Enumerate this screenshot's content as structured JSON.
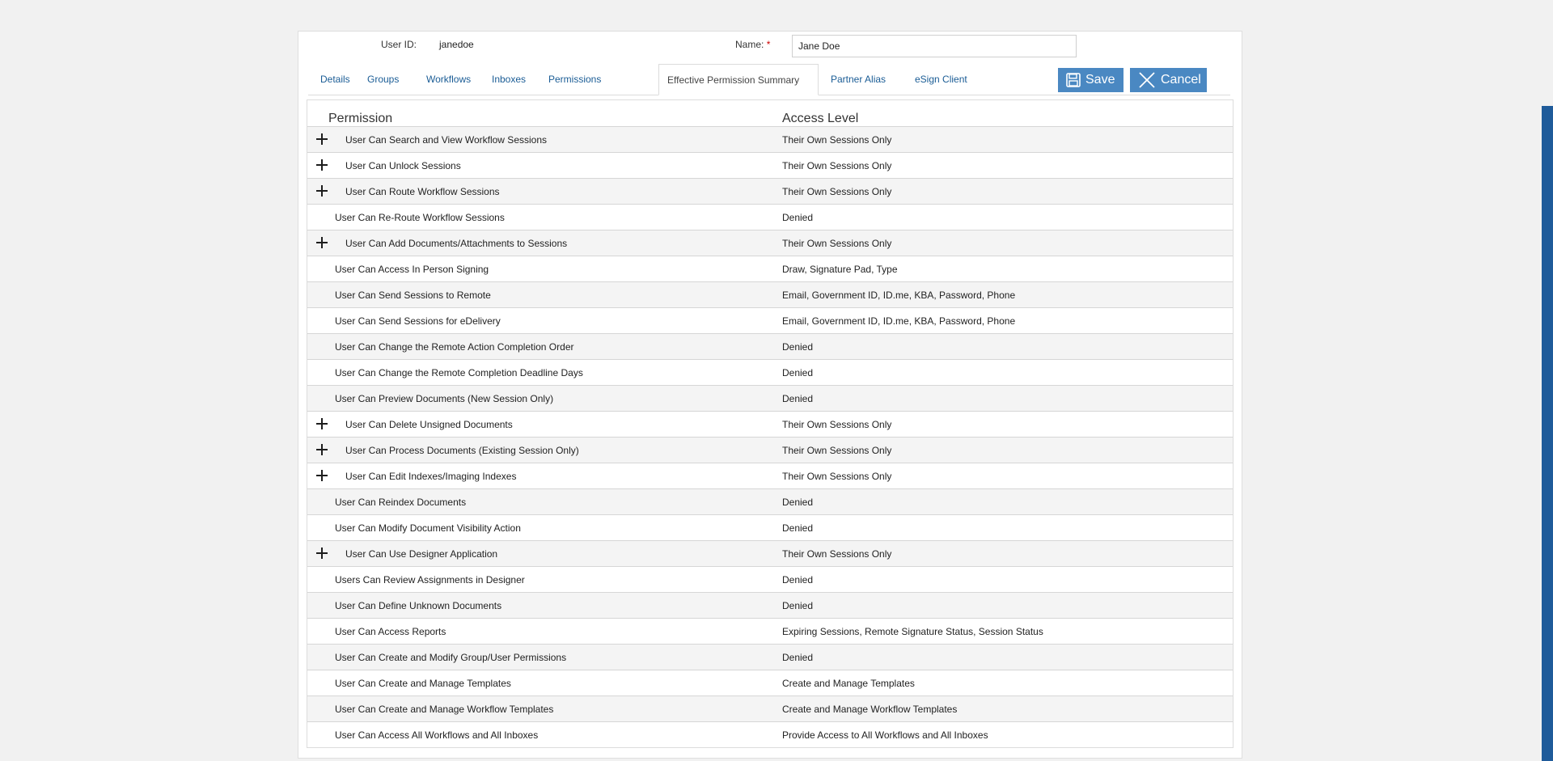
{
  "header": {
    "user_id_label": "User ID:",
    "user_id_value": "janedoe",
    "name_label": "Name:",
    "name_required": "*",
    "name_value": "Jane Doe"
  },
  "tabs": [
    {
      "label": "Details"
    },
    {
      "label": "Groups"
    },
    {
      "label": "Workflows"
    },
    {
      "label": "Inboxes"
    },
    {
      "label": "Permissions"
    },
    {
      "label": "Effective Permission Summary"
    },
    {
      "label": "Partner Alias"
    },
    {
      "label": "eSign Client"
    }
  ],
  "active_tab": "Effective Permission Summary",
  "buttons": {
    "save_label": "Save",
    "cancel_label": "Cancel",
    "save_icon": "floppy-disk-icon",
    "cancel_icon": "close-icon"
  },
  "colors": {
    "accent": "#4a88c2",
    "link": "#1a5c95",
    "required": "#cc0000"
  },
  "table": {
    "columns": [
      "Permission",
      "Access Level"
    ],
    "rows": [
      {
        "permission": "User Can Search and View Workflow Sessions",
        "access": "Their Own Sessions Only",
        "expandable": true
      },
      {
        "permission": "User Can Unlock Sessions",
        "access": "Their Own Sessions Only",
        "expandable": true
      },
      {
        "permission": "User Can Route Workflow Sessions",
        "access": "Their Own Sessions Only",
        "expandable": true
      },
      {
        "permission": "User Can Re-Route Workflow Sessions",
        "access": "Denied",
        "expandable": false
      },
      {
        "permission": "User Can Add Documents/Attachments to Sessions",
        "access": "Their Own Sessions Only",
        "expandable": true
      },
      {
        "permission": "User Can Access In Person Signing",
        "access": "Draw, Signature Pad, Type",
        "expandable": false
      },
      {
        "permission": "User Can Send Sessions to Remote",
        "access": "Email, Government ID, ID.me, KBA, Password, Phone",
        "expandable": false
      },
      {
        "permission": "User Can Send Sessions for eDelivery",
        "access": "Email, Government ID, ID.me, KBA, Password, Phone",
        "expandable": false
      },
      {
        "permission": "User Can Change the Remote Action Completion Order",
        "access": "Denied",
        "expandable": false
      },
      {
        "permission": "User Can Change the Remote Completion Deadline Days",
        "access": "Denied",
        "expandable": false
      },
      {
        "permission": "User Can Preview Documents (New Session Only)",
        "access": "Denied",
        "expandable": false
      },
      {
        "permission": "User Can Delete Unsigned Documents",
        "access": "Their Own Sessions Only",
        "expandable": true
      },
      {
        "permission": "User Can Process Documents (Existing Session Only)",
        "access": "Their Own Sessions Only",
        "expandable": true
      },
      {
        "permission": "User Can Edit Indexes/Imaging Indexes",
        "access": "Their Own Sessions Only",
        "expandable": true
      },
      {
        "permission": "User Can Reindex Documents",
        "access": "Denied",
        "expandable": false
      },
      {
        "permission": "User Can Modify Document Visibility Action",
        "access": "Denied",
        "expandable": false
      },
      {
        "permission": "User Can Use Designer Application",
        "access": "Their Own Sessions Only",
        "expandable": true
      },
      {
        "permission": "Users Can Review Assignments in Designer",
        "access": "Denied",
        "expandable": false
      },
      {
        "permission": "User Can Define Unknown Documents",
        "access": "Denied",
        "expandable": false
      },
      {
        "permission": "User Can Access Reports",
        "access": "Expiring Sessions, Remote Signature Status, Session Status",
        "expandable": false
      },
      {
        "permission": "User Can Create and Modify Group/User Permissions",
        "access": "Denied",
        "expandable": false
      },
      {
        "permission": "User Can Create and Manage Templates",
        "access": "Create and Manage Templates",
        "expandable": false
      },
      {
        "permission": "User Can Create and Manage Workflow Templates",
        "access": "Create and Manage Workflow Templates",
        "expandable": false
      },
      {
        "permission": "User Can Access All Workflows and All Inboxes",
        "access": "Provide Access to All Workflows and All Inboxes",
        "expandable": false
      }
    ]
  }
}
